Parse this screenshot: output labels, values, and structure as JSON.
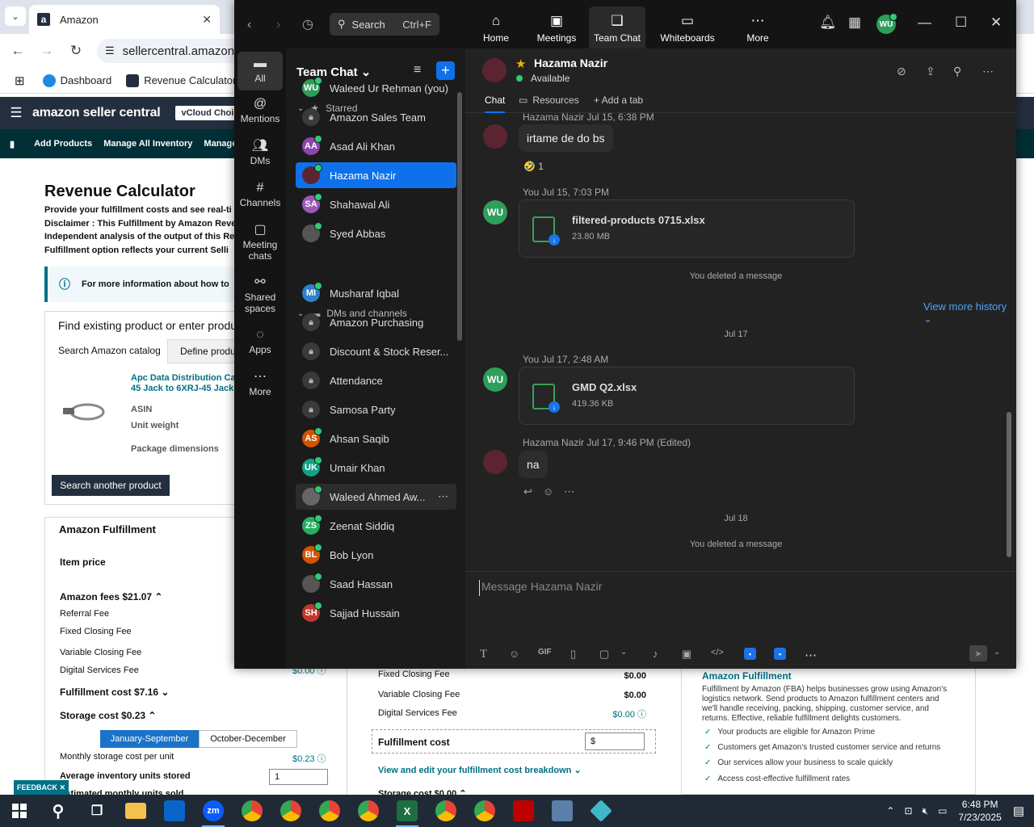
{
  "browser": {
    "tab_title": "Amazon",
    "tab_close": "✕",
    "url": "sellercentral.amazon.c",
    "bookmarks": [
      "Dashboard",
      "Revenue Calculator"
    ]
  },
  "amazon": {
    "logo": "amazon seller central",
    "choice": "vCloud Choice",
    "nav": [
      "Add Products",
      "Manage All Inventory",
      "Manage C"
    ],
    "title": "Revenue Calculator",
    "desc": [
      "Provide your fulfillment costs and see real-ti",
      "Disclaimer : This Fulfillment by Amazon Reve",
      "Independent analysis of the output of this Re",
      "Fulfillment option reflects your current Selli"
    ],
    "info": "For more information about how to",
    "find_title": "Find existing product or enter produc",
    "tab_catalog": "Search Amazon catalog",
    "tab_define": "Define produ",
    "product_name": "Apc Data Distribution Ca 45 Jack to 6XRJ-45 Jack",
    "asin": "ASIN",
    "unit_weight": "Unit weight",
    "package_dims": "Package dimensions",
    "search_another": "Search another product",
    "fulfil_title": "Amazon Fulfillment",
    "item_price": "Item price",
    "amazon_fees": "Amazon fees  $21.07  ⌃",
    "referral": "Referral Fee",
    "fixed_closing": "Fixed Closing Fee",
    "variable_closing": "Variable Closing Fee",
    "digital_services": "Digital Services Fee",
    "digital_val": "$0.00 ⓘ",
    "fulfilment_cost": "Fulfillment cost  $7.16  ⌄",
    "storage_cost": "Storage cost  $0.23  ⌃",
    "season_a": "January-September",
    "season_b": "October-December",
    "monthly_storage": "Monthly storage cost per unit",
    "monthly_val": "$0.23 ⓘ",
    "avg_inventory": "Average inventory units stored",
    "avg_val": "1",
    "est_monthly": "Estimated monthly units sold",
    "feedback": "FEEDBACK ✕",
    "mid_fixed": "Fixed Closing Fee",
    "mid_fixed_val": "$0.00",
    "mid_variable": "Variable Closing Fee",
    "mid_variable_val": "$0.00",
    "mid_digital": "Digital Services Fee",
    "mid_digital_val": "$0.00 ⓘ",
    "mid_fcost": "Fulfillment cost",
    "mid_dollar": "$",
    "view_edit": "View and edit your fulfillment cost breakdown  ⌄",
    "storage_cost_mid": "Storage cost  $0.00  ⌃",
    "af_title": "Amazon Fulfillment",
    "af_desc": "Fulfillment by Amazon (FBA) helps businesses grow using Amazon's logistics network. Send products to Amazon fulfillment centers and we'll handle receiving, packing, shipping, customer service, and returns. Effective, reliable fulfillment delights customers.",
    "af_checks": [
      "Your products are eligible for Amazon Prime",
      "Customers get Amazon's trusted customer service and returns",
      "Our services allow your business to scale quickly",
      "Access cost-effective fulfillment rates"
    ]
  },
  "teams": {
    "search_label": "Search",
    "search_shortcut": "Ctrl+F",
    "tabs": [
      "Home",
      "Meetings",
      "Team Chat",
      "Whiteboards",
      "More"
    ],
    "me_initials": "WU",
    "rail": [
      "All",
      "Mentions",
      "DMs",
      "Channels",
      "Meeting chats",
      "Shared spaces",
      "Apps",
      "More"
    ],
    "list_title": "Team Chat  ⌄",
    "starred_label": "Starred",
    "dms_label": "DMs and channels",
    "starred": [
      {
        "initials": "WU",
        "name": "Waleed Ur Rehman (you)",
        "color": "#2e9e5b"
      },
      {
        "initials": "",
        "name": "Amazon Sales Team",
        "color": "#3a3a3a"
      },
      {
        "initials": "AA",
        "name": "Asad Ali Khan",
        "color": "#8e44ad"
      },
      {
        "initials": "",
        "name": "Hazama Nazir",
        "color": "#5a2530"
      },
      {
        "initials": "SA",
        "name": "Shahawal Ali",
        "color": "#9b59b6"
      },
      {
        "initials": "",
        "name": "Syed Abbas",
        "color": "#555"
      }
    ],
    "dms": [
      {
        "initials": "MI",
        "name": "Musharaf Iqbal",
        "color": "#2f80c9"
      },
      {
        "initials": "",
        "name": "Amazon Purchasing",
        "color": "#3a3a3a"
      },
      {
        "initials": "",
        "name": "Discount & Stock Reser...",
        "color": "#3a3a3a"
      },
      {
        "initials": "",
        "name": "Attendance",
        "color": "#3a3a3a"
      },
      {
        "initials": "",
        "name": "Samosa Party",
        "color": "#3a3a3a"
      },
      {
        "initials": "AS",
        "name": "Ahsan Saqib",
        "color": "#d35400"
      },
      {
        "initials": "UK",
        "name": "Umair Khan",
        "color": "#16a085"
      },
      {
        "initials": "",
        "name": "Waleed Ahmed Aw...",
        "color": "#666"
      },
      {
        "initials": "ZS",
        "name": "Zeenat Siddiq",
        "color": "#27ae60"
      },
      {
        "initials": "BL",
        "name": "Bob Lyon",
        "color": "#d35400"
      },
      {
        "initials": "",
        "name": "Saad Hassan",
        "color": "#555"
      },
      {
        "initials": "SH",
        "name": "Sajjad Hussain",
        "color": "#c0392b"
      }
    ],
    "chat": {
      "name": "Hazama Nazir",
      "status": "Available",
      "tab_chat": "Chat",
      "tab_resources": "Resources",
      "tab_add": "+ Add a tab",
      "msg1_meta": "Hazama Nazir  Jul 15, 6:38 PM",
      "msg1_text": "irtame de do bs",
      "msg1_reaction": "🤣 1",
      "msg2_meta": "You  Jul 15, 7:03 PM",
      "file1_name": "filtered-products 0715.xlsx",
      "file1_size": "23.80 MB",
      "deleted1": "You deleted a message",
      "view_more": "View more history  ⌄",
      "date_jul17": "Jul 17",
      "msg3_meta": "You  Jul 17, 2:48 AM",
      "file2_name": "GMD Q2.xlsx",
      "file2_size": "419.36 KB",
      "msg4_meta": "Hazama Nazir  Jul 17, 9:46 PM (Edited)",
      "msg4_text": "na",
      "date_jul18": "Jul 18",
      "deleted2": "You deleted a message",
      "placeholder": "Message Hazama Nazir"
    }
  },
  "taskbar": {
    "time": "6:48 PM",
    "date": "7/23/2025",
    "zoom_label": "zm",
    "excel_label": "X"
  }
}
